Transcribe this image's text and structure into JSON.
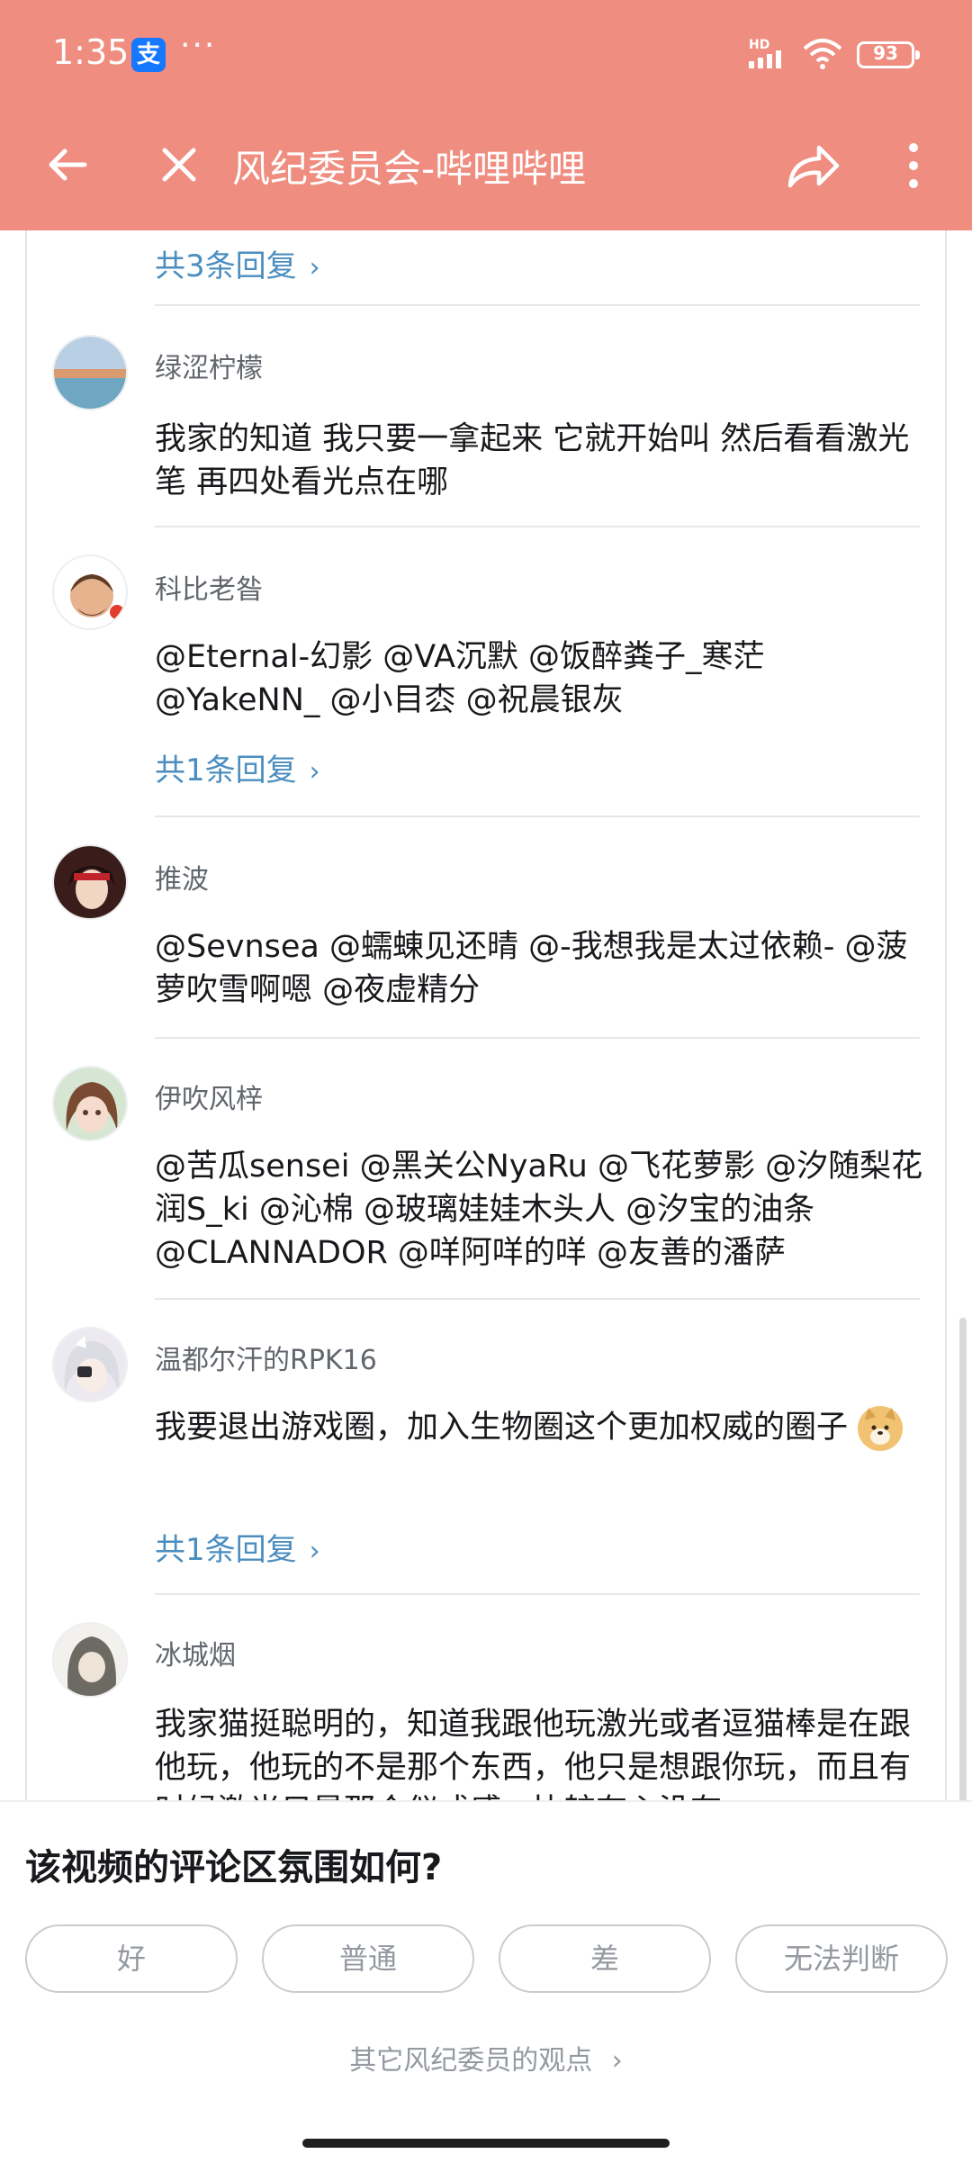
{
  "status_bar": {
    "time": "1:35",
    "alipay_badge": "支",
    "more": "···",
    "hd": "HD",
    "battery": "93"
  },
  "nav": {
    "title": "风纪委员会-哔哩哔哩"
  },
  "comments": [
    {
      "reply_link": "共3条回复"
    },
    {
      "username": "绿涩柠檬",
      "text": "我家的知道 我只要一拿起来 它就开始叫 然后看看激光笔 再四处看光点在哪"
    },
    {
      "username": "科比老昝",
      "text": "@Eternal-幻影 @VA沉默 @饭醉粪子_寒茫 @YakeNN_ @小目枩 @祝晨银灰",
      "reply_link": "共1条回复"
    },
    {
      "username": "推波",
      "text": "@Sevnsea @蠕蝀见还晴 @-我想我是太过依赖- @菠萝吹雪啊嗯 @夜虚精分"
    },
    {
      "username": "伊吹风梓",
      "text": "@苦瓜sensei @黑关公NyaRu @飞花萝影 @汐随梨花润S_ki @沁棉 @玻璃娃娃木头人 @汐宝的油条 @CLANNADOR @咩阿咩的咩 @友善的潘萨"
    },
    {
      "username": "温都尔汗的RPK16",
      "text": "我要退出游戏圈，加入生物圈这个更加权威的圈子",
      "reply_link": "共1条回复"
    },
    {
      "username": "冰城烟",
      "text": "我家猫挺聪明的，知道我跟他玩激光或者逗猫棒是在跟他玩，他玩的不是那个东西，他只是想跟你玩，而且有时候激光只是那个仪式感，比较有心没有"
    }
  ],
  "sheet": {
    "question": "该视频的评论区氛围如何?",
    "options": [
      "好",
      "普通",
      "差",
      "无法判断"
    ],
    "other_view": "其它风纪委员的观点"
  },
  "icons": {
    "back": "back-arrow-icon",
    "close": "close-icon",
    "share": "share-icon",
    "menu": "more-vertical-icon"
  },
  "colors": {
    "header": "#ef8d80",
    "link": "#4b8ebf"
  }
}
